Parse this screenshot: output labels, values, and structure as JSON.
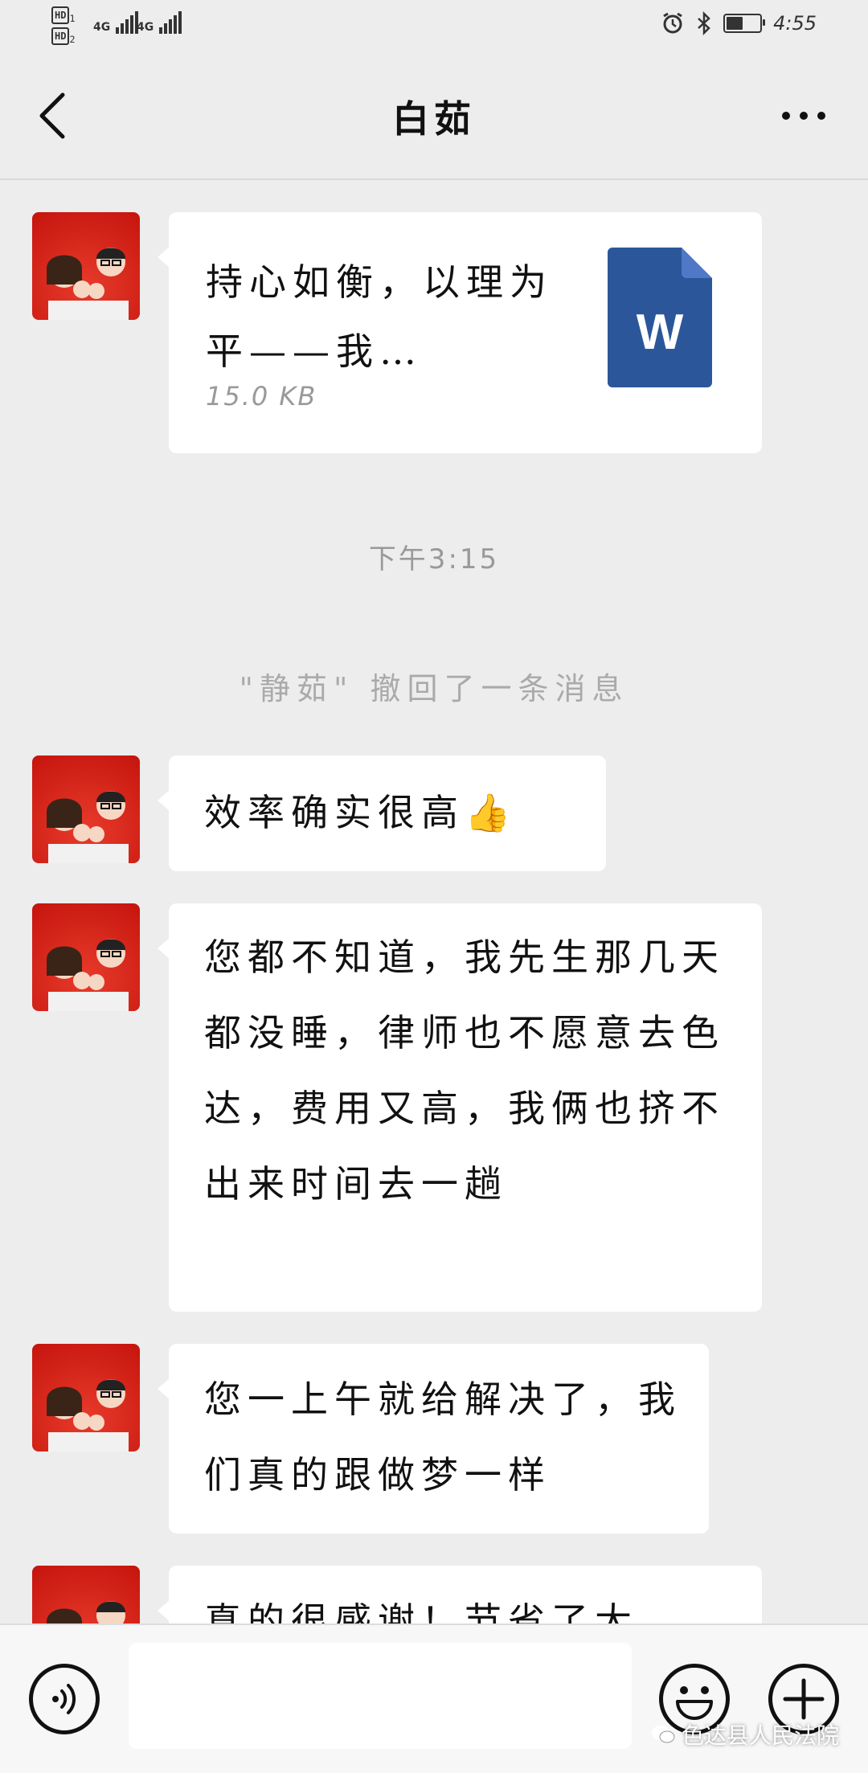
{
  "status_bar": {
    "hd1": "HD",
    "hd1_sub": "1",
    "hd2": "HD",
    "hd2_sub": "2",
    "signal1": "4G",
    "signal2": "4G",
    "time": "4:55",
    "battery_level": 0.55,
    "icons": [
      "alarm-icon",
      "bluetooth-icon",
      "battery-icon"
    ]
  },
  "header": {
    "title": "白茹",
    "back_icon": "chevron-left-icon",
    "more_icon": "more-icon"
  },
  "messages": [
    {
      "type": "file",
      "file_name": "持心如衡，以理为平——我…",
      "file_size": "15.0 KB",
      "file_icon_letter": "W"
    },
    {
      "type": "time",
      "text": "下午3:15"
    },
    {
      "type": "system",
      "text": "\"静茹\" 撤回了一条消息"
    },
    {
      "type": "text",
      "text": "效率确实很高",
      "emoji": "👍"
    },
    {
      "type": "text",
      "text": "您都不知道，我先生那几天都没睡，律师也不愿意去色达，费用又高，我俩也挤不出来时间去一趟"
    },
    {
      "type": "text",
      "text": "您一上午就给解决了，我们真的跟做梦一样"
    },
    {
      "type": "text",
      "text": "真的很感谢！节省了大"
    }
  ],
  "bottom_bar": {
    "input_value": "",
    "voice_icon": "voice-icon",
    "emoji_icon": "emoji-icon",
    "plus_icon": "plus-icon"
  },
  "watermark": "色达县人民法院",
  "colors": {
    "background": "#ededed",
    "bubble": "#ffffff",
    "word_blue": "#2b579a",
    "avatar_red": "#d7221a"
  }
}
